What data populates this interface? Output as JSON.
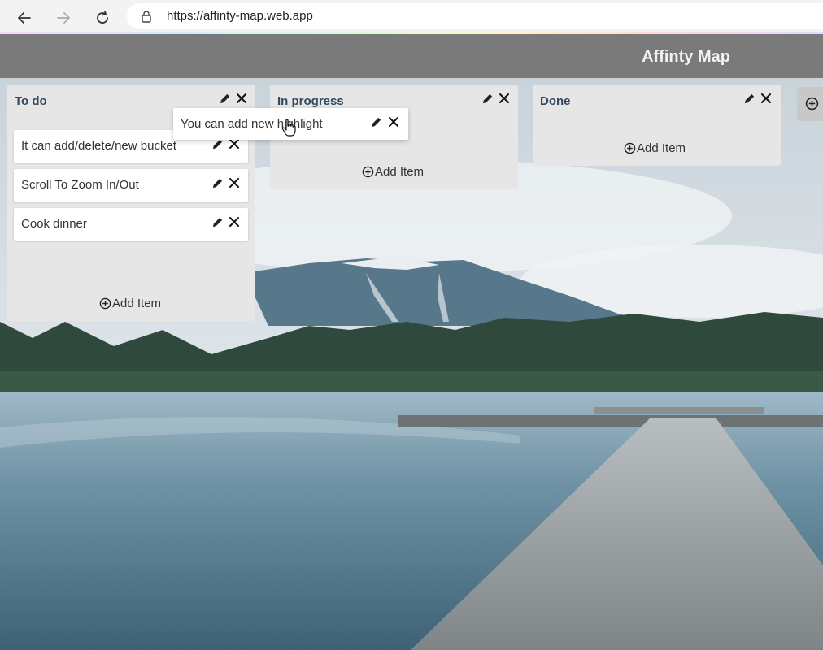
{
  "browser": {
    "url": "https://affinty-map.web.app"
  },
  "app": {
    "title": "Affinty Map"
  },
  "buckets": [
    {
      "title": "To do",
      "items": [
        "It can add/delete/new bucket",
        "Scroll To Zoom In/Out",
        "Cook dinner"
      ],
      "add_label": "Add Item"
    },
    {
      "title": "In progress",
      "items": [],
      "add_label": "Add Item"
    },
    {
      "title": "Done",
      "items": [],
      "add_label": "Add Item"
    }
  ],
  "dragging_item": "You can add new highlight",
  "icons": {
    "edit": "pencil-icon",
    "delete": "close-icon",
    "add": "plus-circle-icon"
  },
  "colors": {
    "header": "#7a7a7a",
    "bucket": "#e6e6e6",
    "card": "#ffffff",
    "title_text": "#34495e"
  }
}
